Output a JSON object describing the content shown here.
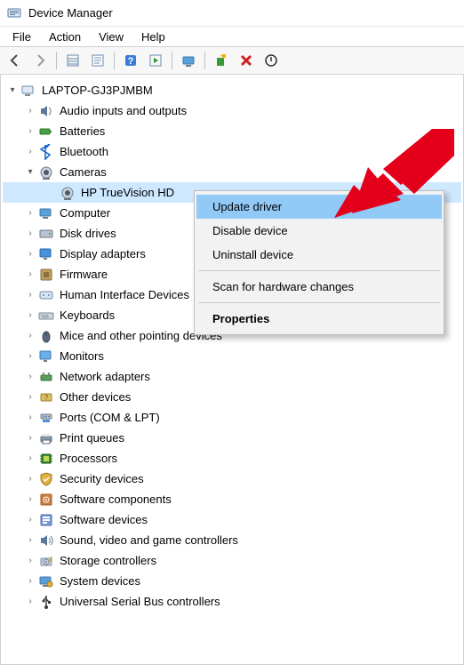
{
  "window": {
    "title": "Device Manager"
  },
  "menubar": {
    "items": [
      "File",
      "Action",
      "View",
      "Help"
    ]
  },
  "toolbar": {
    "buttons": [
      "back-icon",
      "forward-icon",
      "sep",
      "show-hide-tree-icon",
      "sep",
      "help-icon",
      "properties-icon",
      "sep",
      "scan-icon",
      "sep",
      "update-driver-icon",
      "uninstall-icon",
      "disable-icon"
    ]
  },
  "tree": {
    "root": {
      "label": "LAPTOP-GJ3PJMBM",
      "expanded": true
    },
    "children": [
      {
        "label": "Audio inputs and outputs",
        "icon": "speaker-icon",
        "expanded": false
      },
      {
        "label": "Batteries",
        "icon": "battery-icon",
        "expanded": false
      },
      {
        "label": "Bluetooth",
        "icon": "bluetooth-icon",
        "expanded": false
      },
      {
        "label": "Cameras",
        "icon": "camera-icon",
        "expanded": true,
        "children": [
          {
            "label": "HP TrueVision HD",
            "icon": "camera-icon",
            "selected": true
          }
        ]
      },
      {
        "label": "Computer",
        "icon": "computer-icon",
        "expanded": false
      },
      {
        "label": "Disk drives",
        "icon": "disk-icon",
        "expanded": false
      },
      {
        "label": "Display adapters",
        "icon": "display-icon",
        "expanded": false
      },
      {
        "label": "Firmware",
        "icon": "firmware-icon",
        "expanded": false
      },
      {
        "label": "Human Interface Devices",
        "icon": "hid-icon",
        "expanded": false
      },
      {
        "label": "Keyboards",
        "icon": "keyboard-icon",
        "expanded": false
      },
      {
        "label": "Mice and other pointing devices",
        "icon": "mouse-icon",
        "expanded": false
      },
      {
        "label": "Monitors",
        "icon": "monitor-icon",
        "expanded": false
      },
      {
        "label": "Network adapters",
        "icon": "network-icon",
        "expanded": false
      },
      {
        "label": "Other devices",
        "icon": "other-icon",
        "expanded": false
      },
      {
        "label": "Ports (COM & LPT)",
        "icon": "ports-icon",
        "expanded": false
      },
      {
        "label": "Print queues",
        "icon": "printer-icon",
        "expanded": false
      },
      {
        "label": "Processors",
        "icon": "cpu-icon",
        "expanded": false
      },
      {
        "label": "Security devices",
        "icon": "security-icon",
        "expanded": false
      },
      {
        "label": "Software components",
        "icon": "software-comp-icon",
        "expanded": false
      },
      {
        "label": "Software devices",
        "icon": "software-dev-icon",
        "expanded": false
      },
      {
        "label": "Sound, video and game controllers",
        "icon": "sound-icon",
        "expanded": false
      },
      {
        "label": "Storage controllers",
        "icon": "storage-icon",
        "expanded": false
      },
      {
        "label": "System devices",
        "icon": "system-icon",
        "expanded": false
      },
      {
        "label": "Universal Serial Bus controllers",
        "icon": "usb-icon",
        "expanded": false
      }
    ]
  },
  "context_menu": {
    "items": [
      {
        "label": "Update driver",
        "hover": true
      },
      {
        "label": "Disable device"
      },
      {
        "label": "Uninstall device"
      },
      {
        "sep": true
      },
      {
        "label": "Scan for hardware changes"
      },
      {
        "sep": true
      },
      {
        "label": "Properties",
        "bold": true
      }
    ]
  }
}
